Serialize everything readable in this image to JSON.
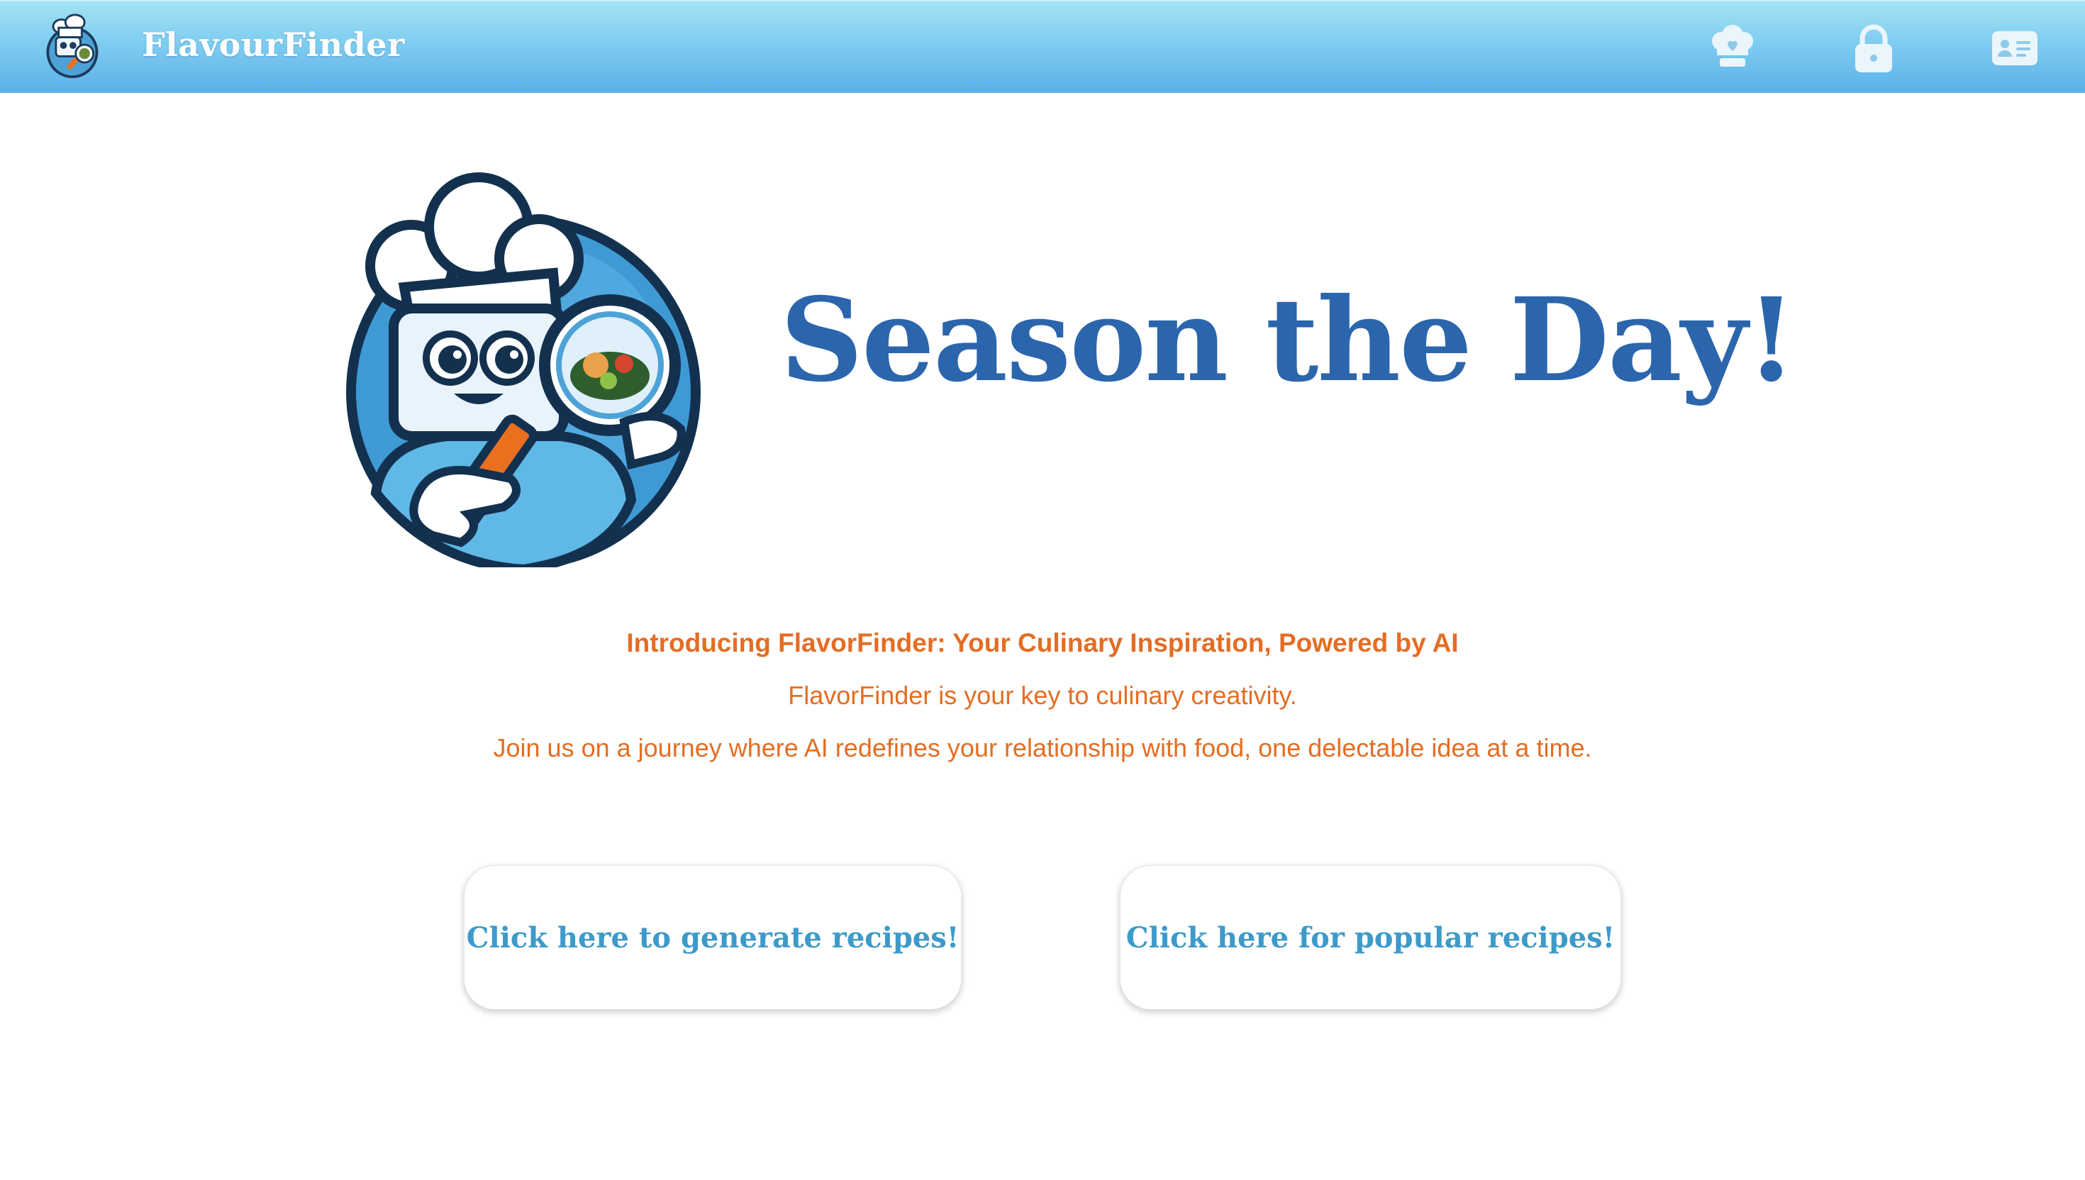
{
  "app": {
    "title": "FlavourFinder"
  },
  "nav": {
    "icons": [
      {
        "name": "chef-hat-heart-icon"
      },
      {
        "name": "lock-icon"
      },
      {
        "name": "id-card-icon"
      }
    ]
  },
  "hero": {
    "headline": "Season the Day!"
  },
  "intro": {
    "title": "Introducing FlavorFinder: Your Culinary Inspiration, Powered by AI",
    "line1": "FlavorFinder is your key to culinary creativity.",
    "line2": "Join us on a journey where AI redefines your relationship with food, one delectable idea at a time."
  },
  "actions": {
    "generate_label": "Click here to generate recipes!",
    "popular_label": "Click here for popular recipes!"
  },
  "colors": {
    "nav_gradient_top": "#a4e3f4",
    "nav_gradient_bottom": "#5bb0ea",
    "headline": "#2b66ad",
    "intro_text": "#e46d24",
    "button_text": "#3d9ac9"
  }
}
